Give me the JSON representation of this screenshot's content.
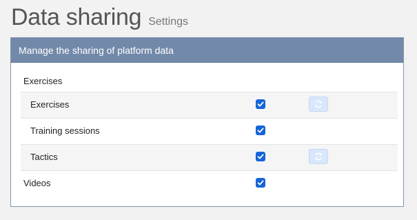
{
  "page": {
    "title": "Data sharing",
    "subtitle": "Settings"
  },
  "panel": {
    "header": "Manage the sharing of platform data",
    "sections": {
      "exercises": {
        "label": "Exercises",
        "items": [
          {
            "label": "Exercises",
            "checked": true,
            "sync_button": true,
            "sync_icon": "refresh-icon"
          },
          {
            "label": "Training sessions",
            "checked": true,
            "sync_button": false
          },
          {
            "label": "Tactics",
            "checked": true,
            "sync_button": true,
            "sync_icon": "refresh-icon"
          }
        ]
      },
      "videos": {
        "label": "Videos",
        "checked": true
      }
    }
  },
  "colors": {
    "panel_header_bg": "#7389aa",
    "checkbox_accent": "#1565d8",
    "sync_button_bg": "#d9e7fb"
  }
}
